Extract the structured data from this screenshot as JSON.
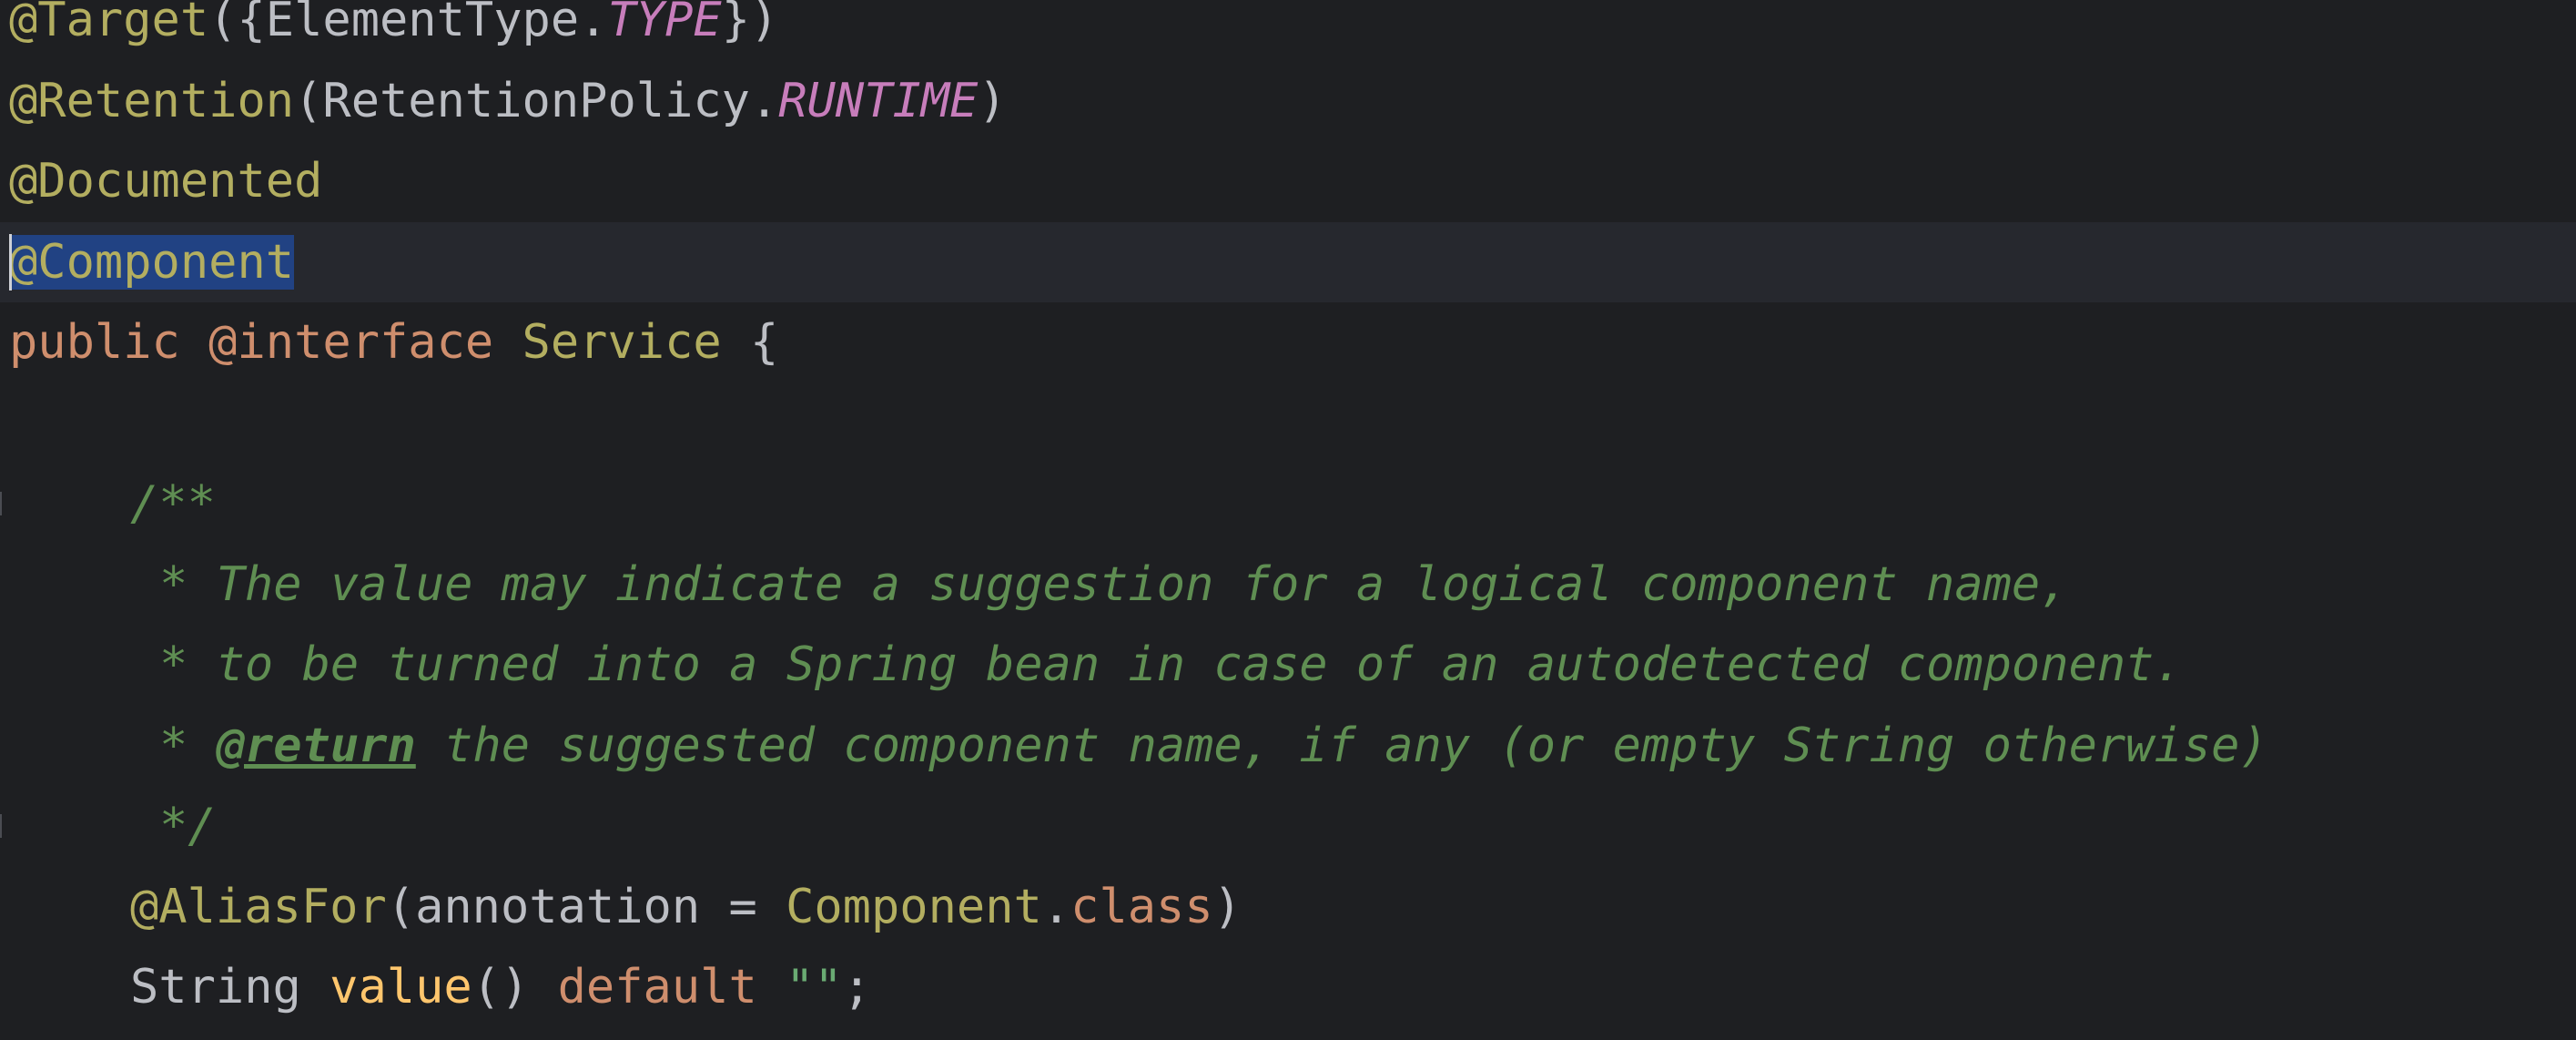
{
  "editor": {
    "language": "Java",
    "lines": [
      {
        "tokens": [
          {
            "t": "@Target",
            "c": "ann"
          },
          {
            "t": "({ElementType.",
            "c": "punc"
          },
          {
            "t": "TYPE",
            "c": "const"
          },
          {
            "t": "})",
            "c": "punc"
          }
        ]
      },
      {
        "tokens": [
          {
            "t": "@Retention",
            "c": "ann"
          },
          {
            "t": "(RetentionPolicy.",
            "c": "punc"
          },
          {
            "t": "RUNTIME",
            "c": "const"
          },
          {
            "t": ")",
            "c": "punc"
          }
        ]
      },
      {
        "tokens": [
          {
            "t": "@Documented",
            "c": "ann"
          }
        ]
      },
      {
        "current": true,
        "tokens": [
          {
            "t": "@Component",
            "c": "selected",
            "caret": true
          }
        ]
      },
      {
        "tokens": [
          {
            "t": "public",
            "c": "kw"
          },
          {
            "t": " ",
            "c": "punc"
          },
          {
            "t": "@interface",
            "c": "kw"
          },
          {
            "t": " ",
            "c": "punc"
          },
          {
            "t": "Service",
            "c": "ann"
          },
          {
            "t": " {",
            "c": "punc"
          }
        ]
      },
      {
        "tokens": []
      },
      {
        "indent": "indent",
        "fold": true,
        "tokens": [
          {
            "t": "/**",
            "c": "doc"
          }
        ]
      },
      {
        "indent": "indent-doc",
        "tokens": [
          {
            "t": "* The value may indicate a suggestion for a logical component name,",
            "c": "doc"
          }
        ]
      },
      {
        "indent": "indent-doc",
        "tokens": [
          {
            "t": "* to be turned into a Spring bean in case of an autodetected component.",
            "c": "doc"
          }
        ]
      },
      {
        "indent": "indent-doc",
        "tokens": [
          {
            "t": "* ",
            "c": "doc"
          },
          {
            "t": "@return",
            "c": "doc-tag"
          },
          {
            "t": " the suggested component name, if any (or empty String otherwise)",
            "c": "doc"
          }
        ]
      },
      {
        "indent": "indent-doc",
        "fold": true,
        "tokens": [
          {
            "t": "*/",
            "c": "doc"
          }
        ]
      },
      {
        "indent": "indent",
        "tokens": [
          {
            "t": "@AliasFor",
            "c": "ann"
          },
          {
            "t": "(annotation = ",
            "c": "punc"
          },
          {
            "t": "Component",
            "c": "ann"
          },
          {
            "t": ".",
            "c": "punc"
          },
          {
            "t": "class",
            "c": "kw"
          },
          {
            "t": ")",
            "c": "punc"
          }
        ]
      },
      {
        "indent": "indent",
        "tokens": [
          {
            "t": "String",
            "c": "type"
          },
          {
            "t": " ",
            "c": "punc"
          },
          {
            "t": "value",
            "c": "method"
          },
          {
            "t": "() ",
            "c": "punc"
          },
          {
            "t": "default",
            "c": "kw"
          },
          {
            "t": " ",
            "c": "punc"
          },
          {
            "t": "\"\"",
            "c": "str"
          },
          {
            "t": ";",
            "c": "punc"
          }
        ]
      }
    ]
  }
}
